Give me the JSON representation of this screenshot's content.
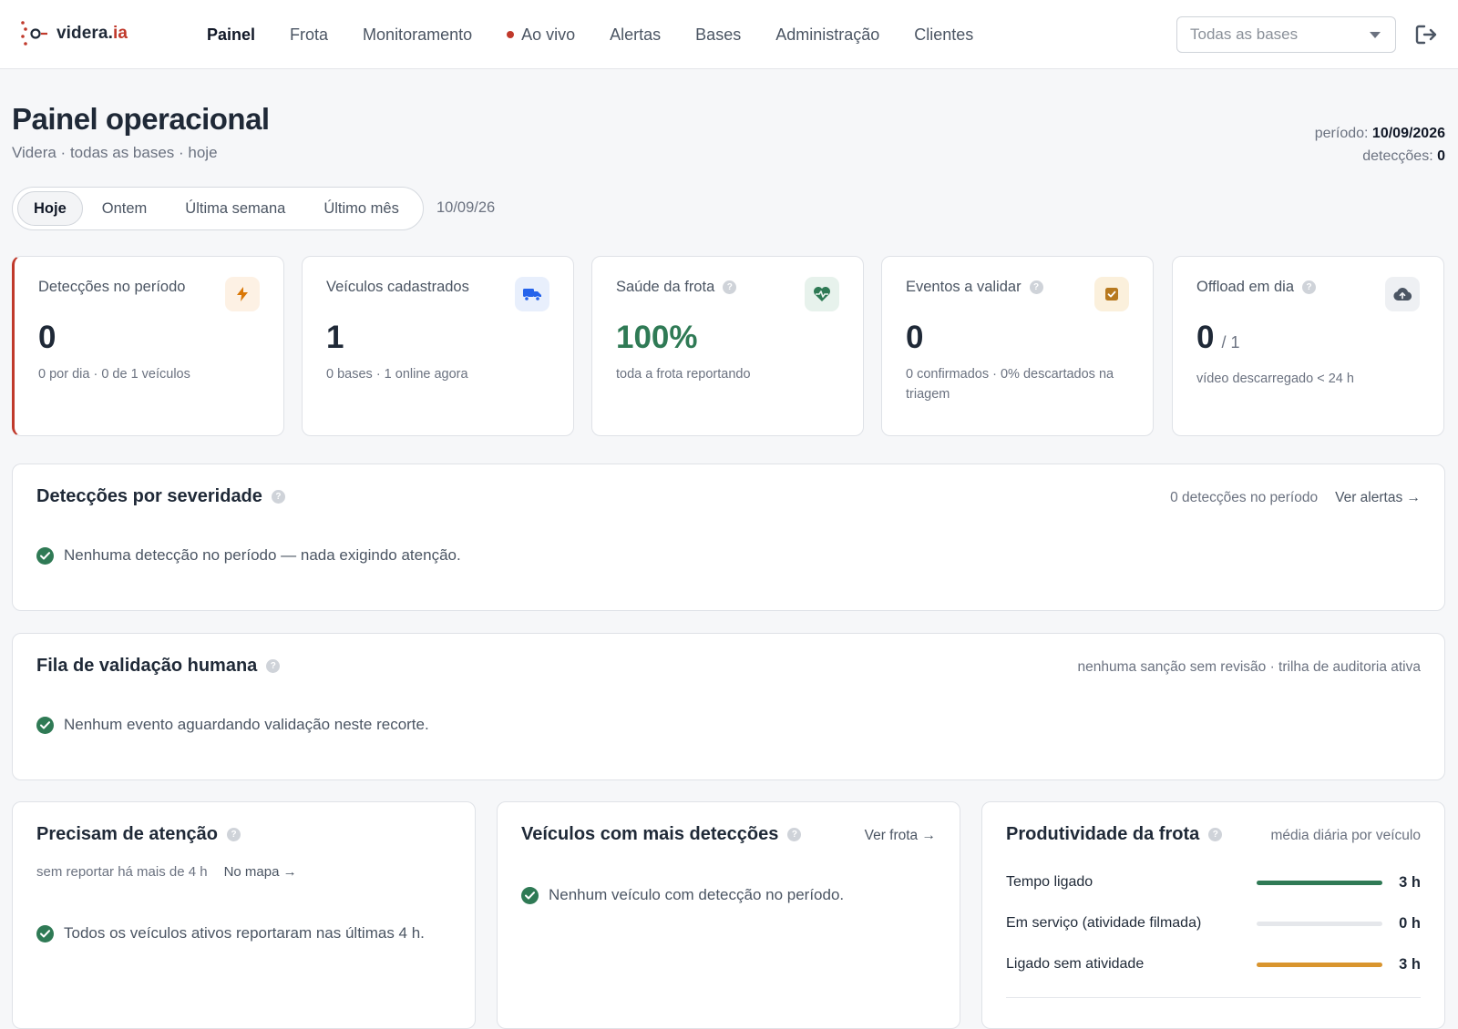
{
  "brand": {
    "name_main": "videra.",
    "name_accent": "ia"
  },
  "nav": {
    "items": [
      {
        "label": "Painel",
        "active": true
      },
      {
        "label": "Frota"
      },
      {
        "label": "Monitoramento"
      },
      {
        "label": "Ao vivo",
        "live": true
      },
      {
        "label": "Alertas"
      },
      {
        "label": "Bases"
      },
      {
        "label": "Administração"
      },
      {
        "label": "Clientes"
      }
    ],
    "base_select": {
      "selected": "Todas as bases"
    },
    "logout_icon": "logout-icon"
  },
  "page": {
    "title": "Painel operacional",
    "subtitle": "Videra · todas as bases · hoje",
    "period_label": "período:",
    "period_value": "10/09/2026",
    "detections_label": "detecções:",
    "detections_value": "0"
  },
  "period_tabs": {
    "tabs": [
      {
        "label": "Hoje",
        "active": true
      },
      {
        "label": "Ontem"
      },
      {
        "label": "Última semana"
      },
      {
        "label": "Último mês"
      }
    ],
    "date": "10/09/26"
  },
  "kpis": [
    {
      "label": "Detecções no período",
      "value": "0",
      "sub": "0 por dia · 0 de 1 veículos",
      "icon": "bolt-icon",
      "color": "#d97706",
      "bg": "#fdf1e4"
    },
    {
      "label": "Veículos cadastrados",
      "value": "1",
      "sub": "0 bases · 1 online agora",
      "icon": "truck-icon",
      "color": "#2563eb",
      "bg": "#e8effc"
    },
    {
      "label": "Saúde da frota",
      "value": "100%",
      "sub": "toda a frota reportando",
      "icon": "heart-pulse-icon",
      "color": "#2f7a55",
      "bg": "#e7f2ec"
    },
    {
      "label": "Eventos a validar",
      "value": "0",
      "sub": "0 confirmados · 0% descartados na triagem",
      "icon": "checkbox-icon",
      "color": "#b7791f",
      "bg": "#fbf0dc"
    },
    {
      "label": "Offload em dia",
      "value": "0",
      "value_of": "/ 1",
      "sub": "vídeo descarregado < 24 h",
      "icon": "cloud-upload-icon",
      "color": "#4b5563",
      "bg": "#eef0f3"
    }
  ],
  "severity": {
    "title": "Detecções por severidade",
    "count_text": "0 detecções no período",
    "link": "Ver alertas →",
    "empty": "Nenhuma detecção no período — nada exigindo atenção."
  },
  "validation": {
    "title": "Fila de validação humana",
    "meta": "nenhuma sanção sem revisão · trilha de auditoria ativa",
    "empty": "Nenhum evento aguardando validação neste recorte."
  },
  "attention": {
    "title": "Precisam de atenção",
    "meta": "sem reportar há mais de 4 h",
    "link": "No mapa →",
    "empty": "Todos os veículos ativos reportaram nas últimas 4 h."
  },
  "top_vehicles": {
    "title": "Veículos com mais detecções",
    "link": "Ver frota →",
    "empty": "Nenhum veículo com detecção no período."
  },
  "productivity": {
    "title": "Produtividade da frota",
    "meta": "média diária por veículo",
    "rows": [
      {
        "label": "Tempo ligado",
        "value": "3 h",
        "fill": 1.0,
        "color": "#2f7a55"
      },
      {
        "label": "Em serviço (atividade filmada)",
        "value": "0 h",
        "fill": 0.0,
        "color": "#e5e7eb"
      },
      {
        "label": "Ligado sem atividade",
        "value": "3 h",
        "fill": 1.0,
        "color": "#d9952e"
      }
    ]
  }
}
